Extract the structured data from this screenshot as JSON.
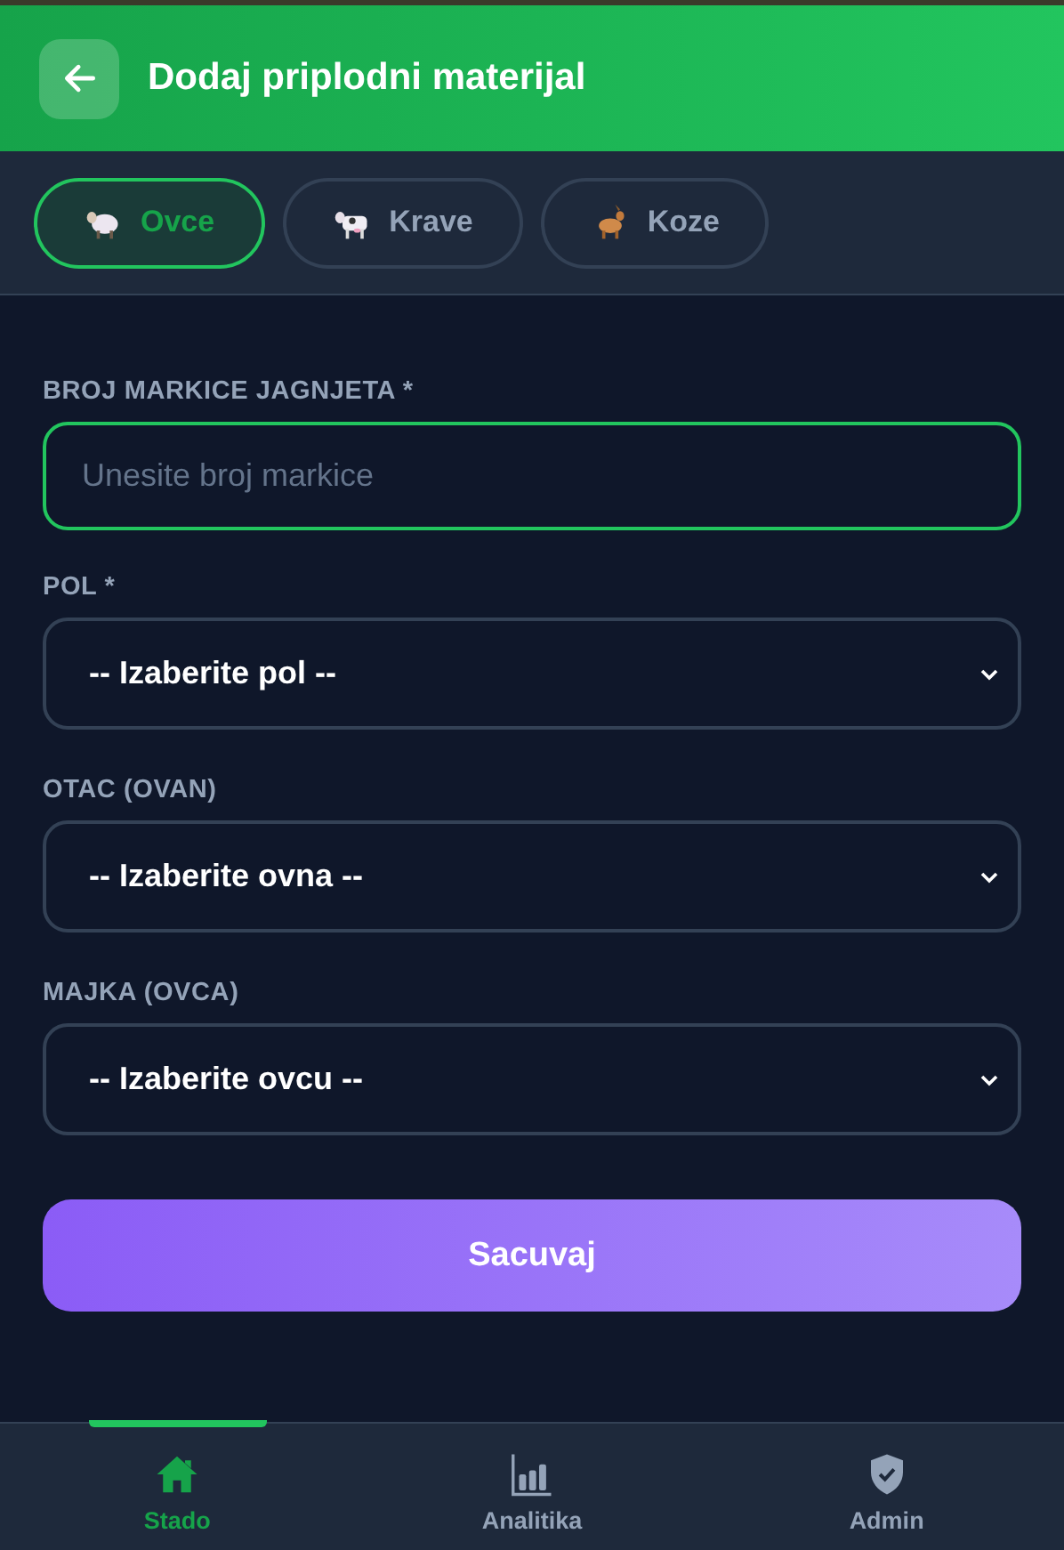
{
  "header": {
    "title": "Dodaj priplodni materijal"
  },
  "animal_tabs": [
    {
      "kind": "sheep",
      "label": "Ovce",
      "selected": true
    },
    {
      "kind": "cow",
      "label": "Krave",
      "selected": false
    },
    {
      "kind": "goat",
      "label": "Koze",
      "selected": false
    }
  ],
  "form": {
    "fields": [
      {
        "kind": "input",
        "label": "BROJ MARKICE JAGNJETA *",
        "placeholder": "Unesite broj markice",
        "focused": true
      },
      {
        "kind": "select",
        "label": "POL *",
        "value": "-- Izaberite pol --",
        "focused": false
      },
      {
        "kind": "select",
        "label": "OTAC (OVAN)",
        "value": "-- Izaberite ovna --",
        "focused": false
      },
      {
        "kind": "select",
        "label": "MAJKA (OVCA)",
        "value": "-- Izaberite ovcu --",
        "focused": false
      }
    ],
    "submit": "Sacuvaj"
  },
  "bottom_nav": [
    {
      "kind": "home",
      "label": "Stado",
      "selected": true
    },
    {
      "kind": "chart",
      "label": "Analitika",
      "selected": false
    },
    {
      "kind": "shield",
      "label": "Admin",
      "selected": false
    }
  ]
}
